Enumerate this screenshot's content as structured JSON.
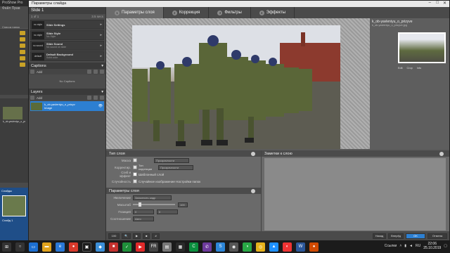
{
  "bg_app": {
    "title": "ProShow Pro",
    "menu": "Файл  Прав",
    "folders_label": "Список папок",
    "files_label": "Список файлов",
    "file_name": "k_ob-yavleniyu_o_prizyve",
    "slides_label": "Слайды",
    "slide_label": "Слайд 1"
  },
  "dialog": {
    "title": "Параметры слайда",
    "tabs": [
      {
        "num": "1",
        "label": "Параметры слоя"
      },
      {
        "num": "2",
        "label": "Коррекция"
      },
      {
        "num": "3",
        "label": "Фильтры"
      },
      {
        "num": "4",
        "label": "Эффекты"
      }
    ]
  },
  "left_panel": {
    "slide_title": "Slide 1",
    "slide_sub_left": "1 of 1",
    "slide_sub_right": "3.5 secs",
    "rows": [
      {
        "thumb": "no style",
        "title": "Slide Settings",
        "sub": ""
      },
      {
        "thumb": "no style",
        "title": "Slide Style",
        "sub": "No Style"
      },
      {
        "thumb": "no sound",
        "title": "Slide Sound",
        "sub": "No sound on slide"
      },
      {
        "thumb": "default",
        "title": "Default Background",
        "sub": "Solid color"
      }
    ],
    "captions_title": "Captions",
    "add_label": "Add",
    "no_captions": "No Captions",
    "layers_title": "Layers",
    "layer_name": "k_ob-yavleniyu_o_prizyv",
    "layer_sub": "Image"
  },
  "right_panel": {
    "name": "k_ob-yavleniyu_o_prizyve",
    "file": "k_ob-yavleniyu_o_prizyve.jpg",
    "buttons": [
      "Edit",
      "Crop",
      "Info"
    ]
  },
  "layer_type": {
    "title": "Тип слоя",
    "rows": [
      {
        "label": "Маска",
        "value": "Прозрачности",
        "checked": false
      },
      {
        "label": "Корректир.",
        "value": "Прозрачности",
        "checked": false,
        "text": "Тип коррекции"
      },
      {
        "label": "Сгиб и эффект",
        "value": "",
        "checked": true,
        "text": "Шаблонный слой"
      },
      {
        "label": "Случайность",
        "value": "",
        "checked": false,
        "text": "Случайное изображение  Настройки папок"
      }
    ]
  },
  "layer_params": {
    "title": "Параметры слоя",
    "scale_label": "Заполнить кадр",
    "rows": [
      "Увеличение",
      "Масштаб",
      "Позиция",
      "Соотношение"
    ],
    "zoom_value": "100",
    "pos_x": "0",
    "pos_y": "0",
    "aspect": "Авто"
  },
  "notes": {
    "title": "Заметки к слою"
  },
  "bottom_bar": {
    "zoom": "100",
    "prev": "Назад",
    "next": "Вперёд",
    "ok": "OK",
    "cancel": "Отмена"
  },
  "taskbar": {
    "lang": "RU",
    "links": "Ссылки",
    "time": "22:06",
    "date": "25.10.2019"
  }
}
